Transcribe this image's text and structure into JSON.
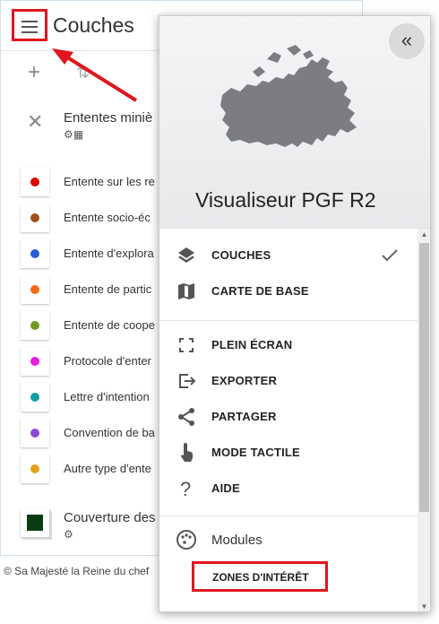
{
  "background": {
    "title": "Couches",
    "group": {
      "title": "Ententes miniè",
      "sub_icons": "⚙▦"
    },
    "legend": [
      {
        "label": "Entente sur les re",
        "color": "#e00000"
      },
      {
        "label": "Entente socio-éc",
        "color": "#a0521a"
      },
      {
        "label": "Entente d'explora",
        "color": "#2a5bd7"
      },
      {
        "label": "Entente de partic",
        "color": "#f56a12"
      },
      {
        "label": "Entente de coope",
        "color": "#6f9b25"
      },
      {
        "label": "Protocole d'enter",
        "color": "#e51ce0"
      },
      {
        "label": "Lettre d'intention",
        "color": "#129e9e"
      },
      {
        "label": "Convention de ba",
        "color": "#8a4ad6"
      },
      {
        "label": "Autre type d'ente",
        "color": "#e5a01a"
      }
    ],
    "couverture": {
      "title": "Couverture des",
      "sub_icon": "⚙",
      "swatch_color": "#083d12"
    },
    "footer": "© Sa Majesté la Reine du chef"
  },
  "drawer": {
    "title": "Visualiseur PGF R2",
    "collapse_icon": "«",
    "items": [
      {
        "label": "COUCHES",
        "icon": "layers-icon",
        "checked": true
      },
      {
        "label": "CARTE DE BASE",
        "icon": "map-icon"
      },
      {
        "label": "PLEIN ÉCRAN",
        "icon": "fullscreen-icon"
      },
      {
        "label": "EXPORTER",
        "icon": "export-icon"
      },
      {
        "label": "PARTAGER",
        "icon": "share-icon"
      },
      {
        "label": "MODE TACTILE",
        "icon": "touch-icon"
      },
      {
        "label": "AIDE",
        "icon": "help-icon"
      }
    ],
    "modules": {
      "label": "Modules",
      "icon": "palette-icon",
      "zones_label": "ZONES D'INTÉRÊT"
    }
  },
  "colors": {
    "highlight_red": "#e0161e"
  }
}
